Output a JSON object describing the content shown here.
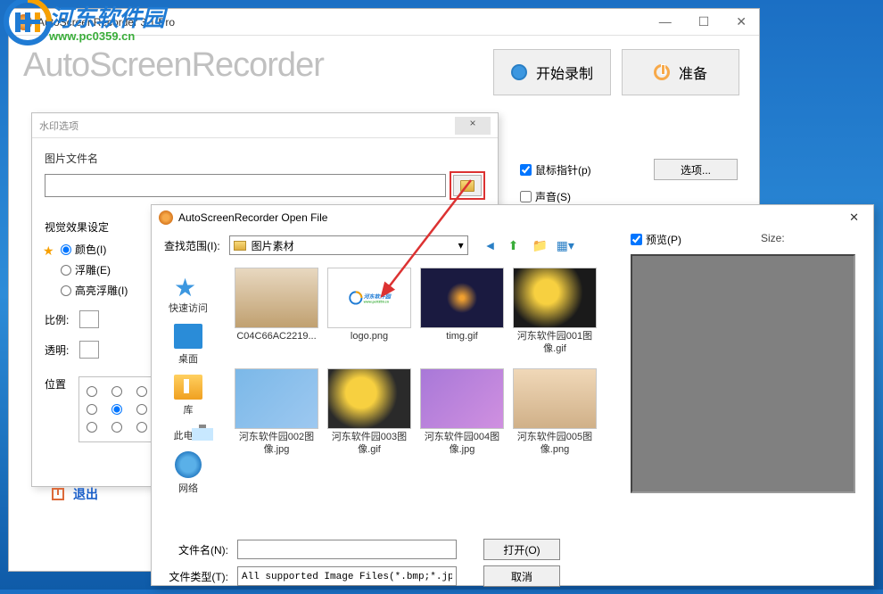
{
  "main_window": {
    "title": "AutoScreenRecorder 3.1 Pro",
    "app_title": "AutoScreenRecorder",
    "start_record": "开始录制",
    "prepare": "准备"
  },
  "watermark_site": {
    "chinese": "河东软件园",
    "url": "www.pc0359.cn"
  },
  "watermark_dialog": {
    "title": "水印选项",
    "image_filename_label": "图片文件名",
    "visual_effect_label": "视觉效果设定",
    "radio_color": "颜色(I)",
    "radio_emboss": "浮雕(E)",
    "radio_highlight": "高亮浮雕(I)",
    "scale_label": "比例:",
    "transparent_label": "透明:",
    "position_label": "位置",
    "exit_label": "退出"
  },
  "side_panel": {
    "mouse_pointer": "鼠标指针(p)",
    "options_btn": "选项...",
    "sound": "声音(S)"
  },
  "open_dialog": {
    "title": "AutoScreenRecorder Open File",
    "look_in_label": "查找范围(I):",
    "folder_name": "图片素材",
    "preview_label": "预览(P)",
    "size_label": "Size:",
    "sidebar": {
      "quick_access": "快速访问",
      "desktop": "桌面",
      "library": "库",
      "this_pc": "此电脑",
      "network": "网络"
    },
    "files": [
      "C04C66AC2219...",
      "logo.png",
      "timg.gif",
      "河东软件园001图像.gif",
      "河东软件园002图像.jpg",
      "河东软件园003图像.gif",
      "河东软件园004图像.jpg",
      "河东软件园005图像.png"
    ],
    "filename_label": "文件名(N):",
    "filetype_label": "文件类型(T):",
    "filetype_value": "All supported Image Files(*.bmp;*.jpg ▾",
    "open_btn": "打开(O)",
    "cancel_btn": "取消"
  }
}
